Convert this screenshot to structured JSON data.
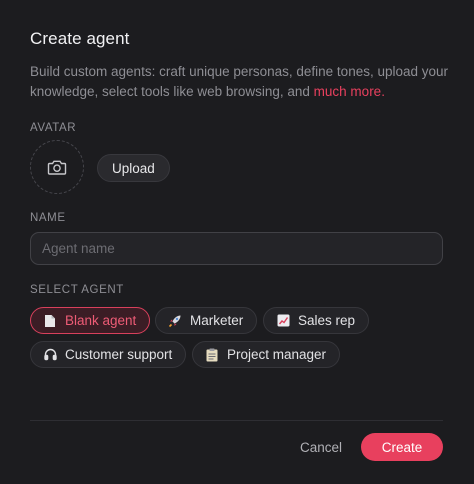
{
  "dialog": {
    "title": "Create agent",
    "description_prefix": "Build custom agents: craft unique personas, define tones, upload your knowledge, select tools like web browsing, and ",
    "description_link": "much more."
  },
  "avatar": {
    "label": "AVATAR",
    "upload_label": "Upload",
    "icon": "camera-icon"
  },
  "name": {
    "label": "NAME",
    "placeholder": "Agent name",
    "value": ""
  },
  "select_agent": {
    "label": "SELECT AGENT",
    "options": [
      {
        "label": "Blank agent",
        "icon": "document-icon",
        "selected": true
      },
      {
        "label": "Marketer",
        "icon": "rocket-icon",
        "selected": false
      },
      {
        "label": "Sales rep",
        "icon": "chart-icon",
        "selected": false
      },
      {
        "label": "Customer support",
        "icon": "headphones-icon",
        "selected": false
      },
      {
        "label": "Project manager",
        "icon": "clipboard-icon",
        "selected": false
      }
    ]
  },
  "footer": {
    "cancel_label": "Cancel",
    "create_label": "Create"
  },
  "colors": {
    "accent": "#e8405e",
    "background": "#1c1c1f"
  }
}
